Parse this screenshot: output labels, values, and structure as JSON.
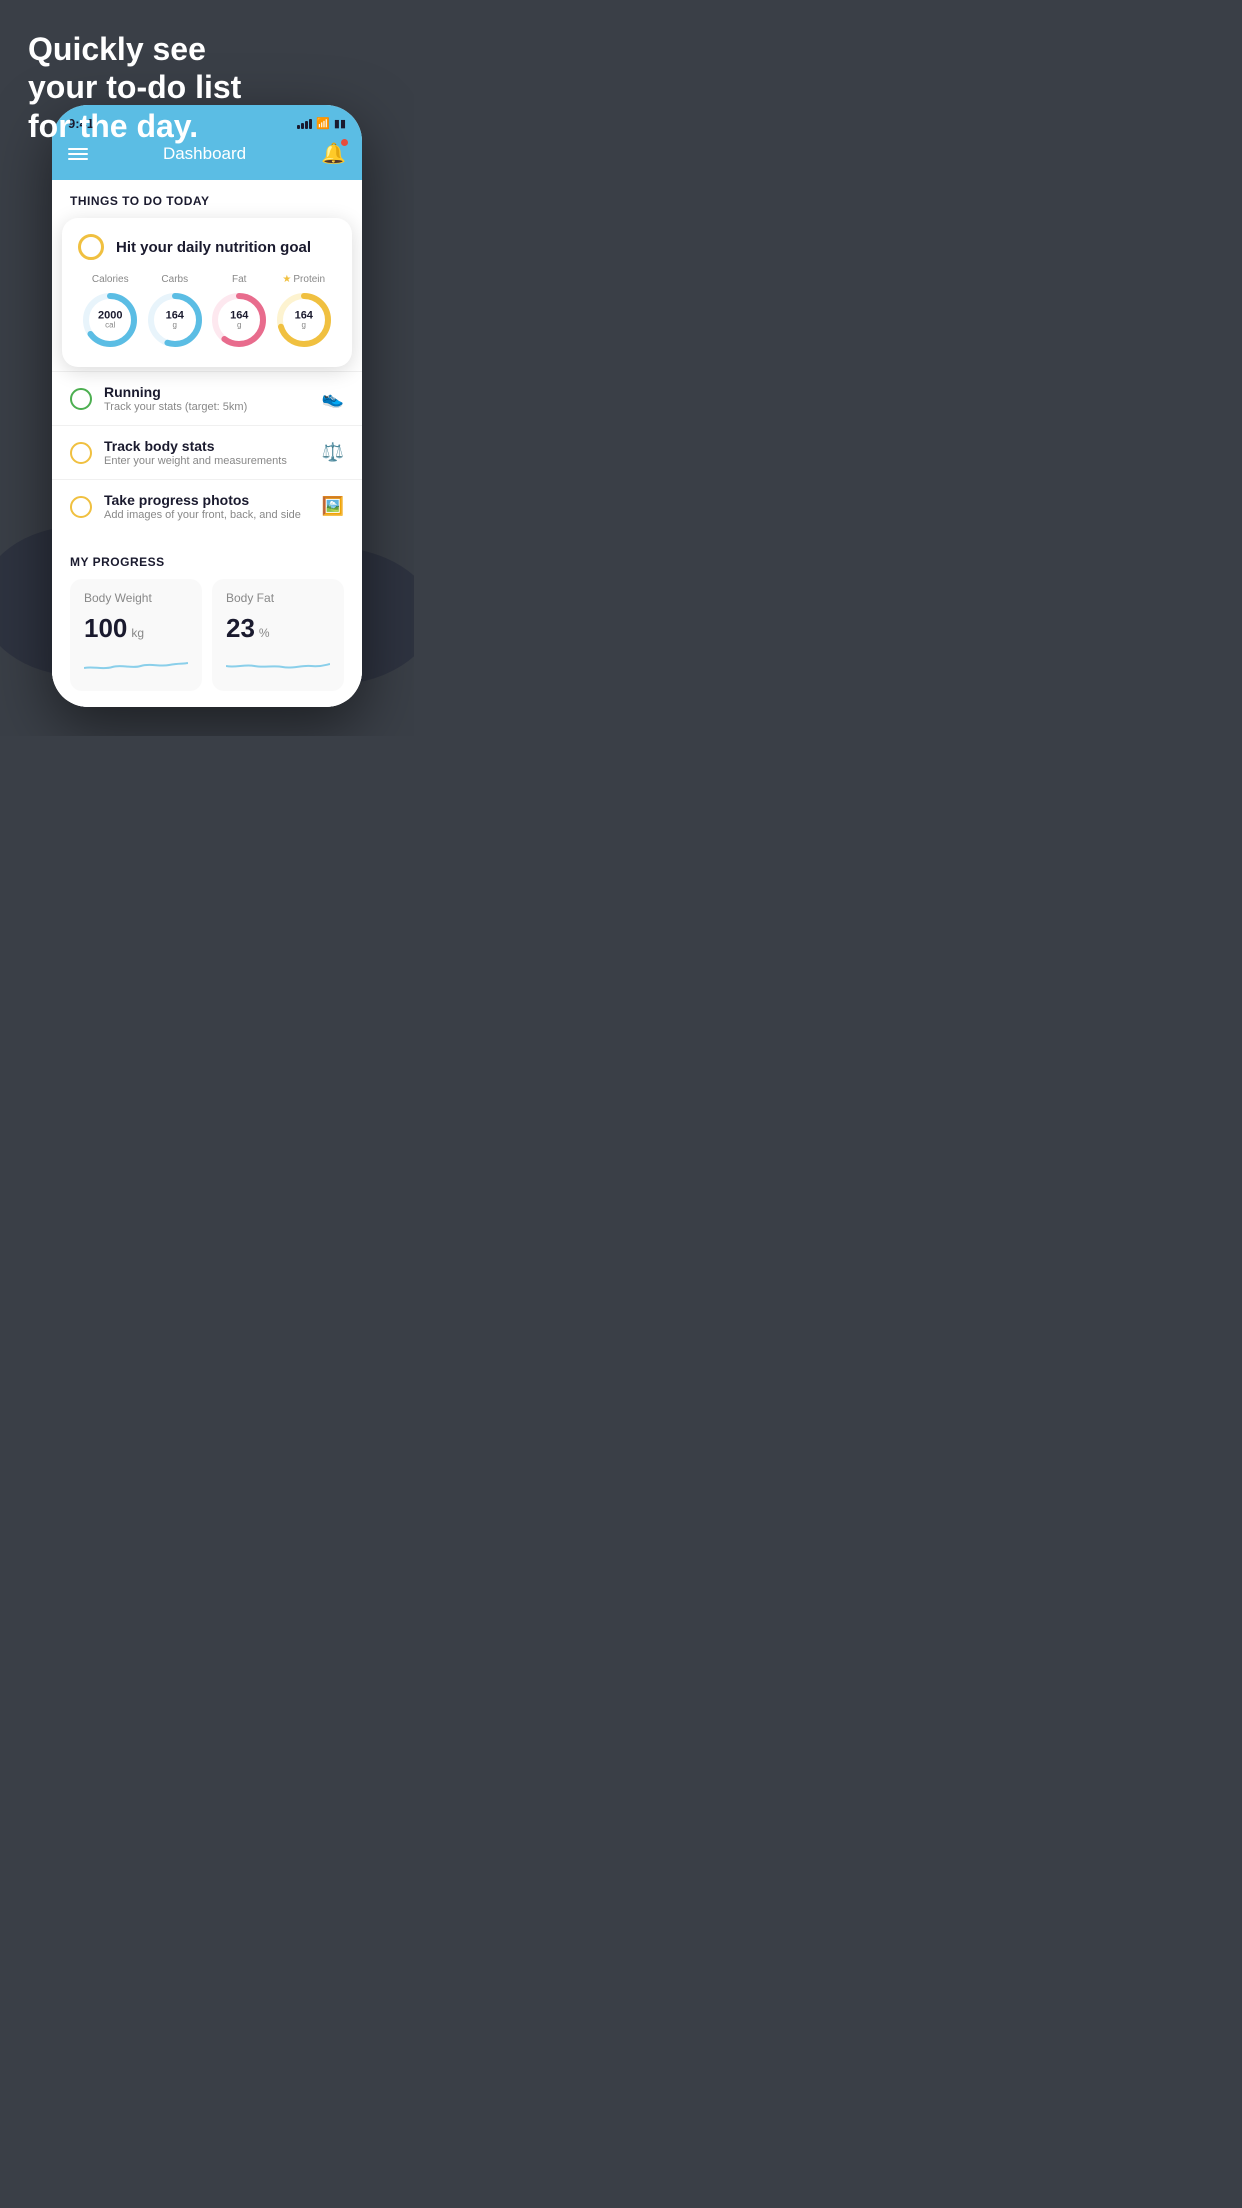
{
  "hero": {
    "line1": "Quickly see",
    "line2": "your to-do list",
    "line3": "for the day."
  },
  "phone": {
    "statusBar": {
      "time": "9:41"
    },
    "header": {
      "title": "Dashboard"
    },
    "thingsToDo": {
      "sectionLabel": "THINGS TO DO TODAY",
      "highlightCard": {
        "circleColor": "#f0c040",
        "title": "Hit your daily nutrition goal",
        "nutrition": [
          {
            "label": "Calories",
            "value": "2000",
            "unit": "cal",
            "color": "#5bbde4",
            "percent": 65
          },
          {
            "label": "Carbs",
            "value": "164",
            "unit": "g",
            "color": "#5bbde4",
            "percent": 55
          },
          {
            "label": "Fat",
            "value": "164",
            "unit": "g",
            "color": "#e86c8d",
            "percent": 60
          },
          {
            "label": "Protein",
            "value": "164",
            "unit": "g",
            "color": "#f0c040",
            "percent": 70,
            "starred": true
          }
        ]
      },
      "todoItems": [
        {
          "id": "running",
          "circleType": "green",
          "title": "Running",
          "subtitle": "Track your stats (target: 5km)",
          "icon": "👟"
        },
        {
          "id": "body-stats",
          "circleType": "yellow",
          "title": "Track body stats",
          "subtitle": "Enter your weight and measurements",
          "icon": "⚖️"
        },
        {
          "id": "progress-photos",
          "circleType": "yellow",
          "title": "Take progress photos",
          "subtitle": "Add images of your front, back, and side",
          "icon": "🖼️"
        }
      ]
    },
    "myProgress": {
      "sectionLabel": "MY PROGRESS",
      "cards": [
        {
          "id": "body-weight",
          "title": "Body Weight",
          "value": "100",
          "unit": "kg"
        },
        {
          "id": "body-fat",
          "title": "Body Fat",
          "value": "23",
          "unit": "%"
        }
      ]
    }
  }
}
